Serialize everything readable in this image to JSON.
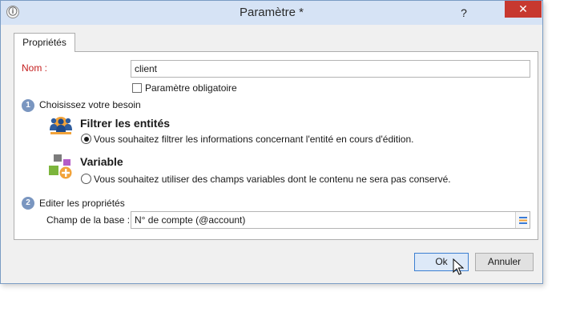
{
  "window": {
    "title": "Paramètre *",
    "help_glyph": "?",
    "close_glyph": "✕",
    "app_icon_glyph": "ⓘ"
  },
  "tabs": [
    {
      "label": "Propriétés"
    }
  ],
  "form": {
    "name_label": "Nom :",
    "name_value": "client",
    "mandatory_label": "Paramètre obligatoire",
    "mandatory_checked": false
  },
  "section1": {
    "number": "1",
    "title": "Choisissez votre besoin",
    "options": [
      {
        "heading": "Filtrer les entités",
        "text": "Vous souhaitez filtrer les informations concernant l'entité en cours d'édition.",
        "selected": true,
        "icon": "people-icon"
      },
      {
        "heading": "Variable",
        "text": "Vous souhaitez utiliser des champs variables dont le contenu ne sera pas conservé.",
        "selected": false,
        "icon": "variable-icon"
      }
    ]
  },
  "section2": {
    "number": "2",
    "title": "Editer les propriétés",
    "field_label": "Champ de la base :",
    "field_value": "N° de compte (@account)"
  },
  "buttons": {
    "ok": "Ok",
    "cancel": "Annuler"
  },
  "colors": {
    "title_bar": "#d6e3f5",
    "close_button": "#c7382f",
    "required_label": "#c41e1e",
    "step_badge": "#7a96c0",
    "ok_border": "#3c7fd1"
  }
}
